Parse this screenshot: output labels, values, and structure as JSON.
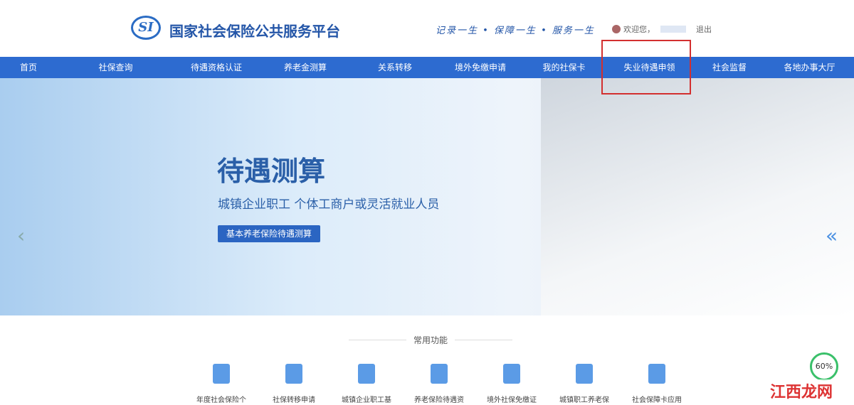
{
  "header": {
    "logo_text": "SI",
    "title": "国家社会保险公共服务平台",
    "slogan": "记录一生 • 保障一生 • 服务一生",
    "welcome": "欢迎您，",
    "logout": "退出"
  },
  "nav": [
    "首页",
    "社保查询",
    "待遇资格认证",
    "养老金测算",
    "关系转移",
    "境外免缴申请",
    "我的社保卡",
    "失业待遇申领",
    "社会监督",
    "各地办事大厅"
  ],
  "highlight_color": "#d32f2f",
  "banner": {
    "title": "待遇测算",
    "subtitle": "城镇企业职工  个体工商户或灵活就业人员",
    "button": "基本养老保险待遇测算"
  },
  "common": {
    "title": "常用功能",
    "items": [
      "年度社会保险个",
      "社保转移申请",
      "城镇企业职工基",
      "养老保险待遇资",
      "境外社保免缴证",
      "城镇职工养老保",
      "社会保障卡应用"
    ]
  },
  "gauge": "60%",
  "watermark": "江西龙网"
}
